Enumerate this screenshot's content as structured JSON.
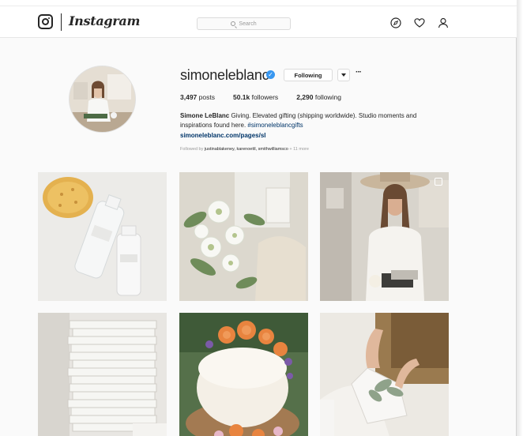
{
  "header": {
    "wordmark": "Instagram",
    "search_placeholder": "Search"
  },
  "profile": {
    "username": "simoneleblanc",
    "following_button": "Following",
    "more_glyph": "···",
    "stats": {
      "posts_count": "3,497",
      "posts_label": "posts",
      "followers_count": "50.1k",
      "followers_label": "followers",
      "following_count": "2,290",
      "following_label": "following"
    },
    "bio": {
      "name": "Simone LeBlanc",
      "text": "Giving. Elevated gifting (shipping worldwide). Studio moments and inspirations found here.",
      "hashtag": "#simoneleblancgifts",
      "link": "simoneleblanc.com/pages/sl"
    },
    "followed_by": {
      "prefix": "Followed by",
      "names": "justinablakeney, karenoettl, smithwilliamsco",
      "suffix": "+ 11 more"
    }
  },
  "posts": [
    {
      "subject": "sponge and skincare bottles"
    },
    {
      "subject": "white flower bouquet with gift boxes"
    },
    {
      "subject": "woman in hat wrapping gift"
    },
    {
      "subject": "stack of white books"
    },
    {
      "subject": "cake with orange flowers"
    },
    {
      "subject": "hands arranging gift with greenery"
    }
  ],
  "colors": {
    "accent_blue": "#3897f0",
    "link_navy": "#003569",
    "text": "#262626",
    "muted": "#999999",
    "background": "#fafafa"
  },
  "icons": [
    "instagram-logo-icon",
    "search-icon",
    "explore-compass-icon",
    "heart-icon",
    "profile-icon",
    "verified-badge-icon",
    "dropdown-arrow-icon",
    "multi-photo-icon"
  ]
}
